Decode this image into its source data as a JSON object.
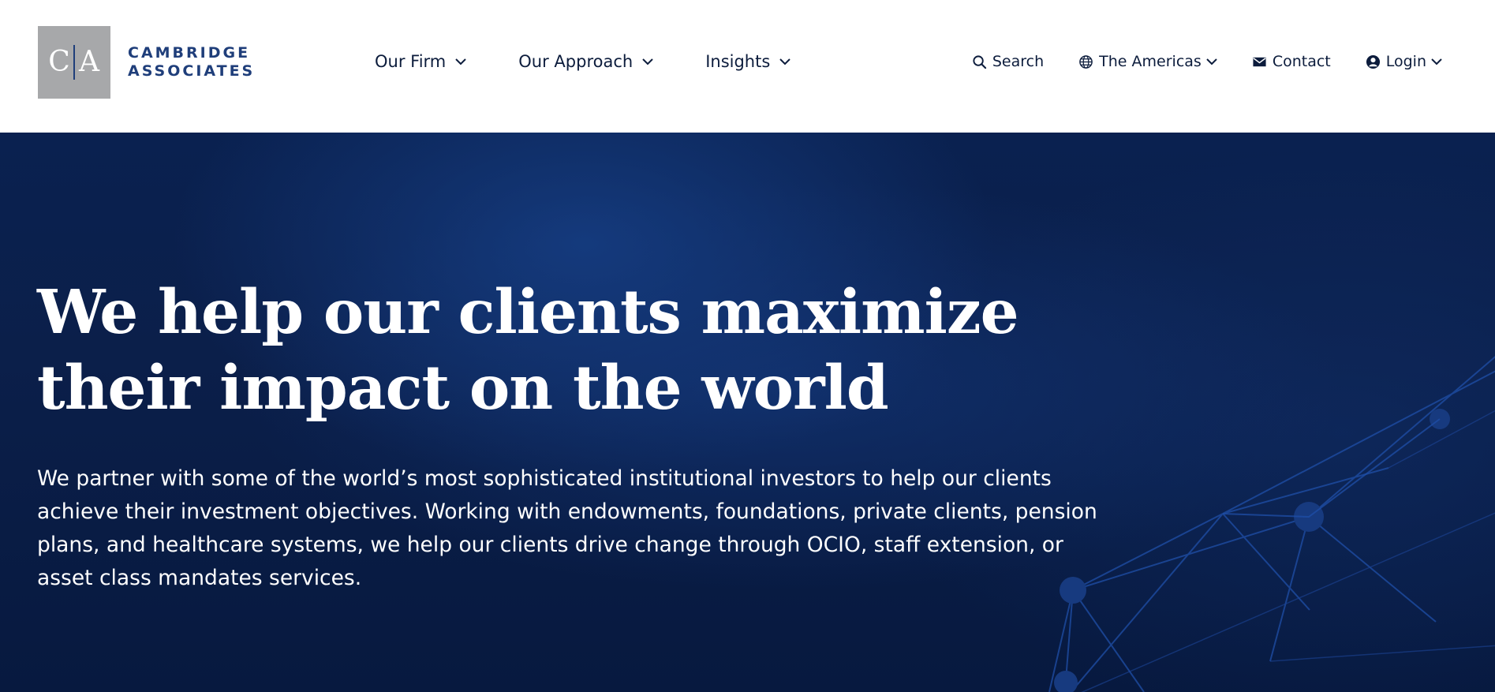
{
  "brand": {
    "logo_left_letter": "C",
    "logo_right_letter": "A",
    "name_line1": "CAMBRIDGE",
    "name_line2": "ASSOCIATES",
    "accent_color": "#1f3e7a",
    "logo_bg_color": "#a7a8aa"
  },
  "nav": {
    "items": [
      {
        "label": "Our Firm",
        "icon": "chevron-down-icon"
      },
      {
        "label": "Our Approach",
        "icon": "chevron-down-icon"
      },
      {
        "label": "Insights",
        "icon": "chevron-down-icon"
      }
    ]
  },
  "utilities": {
    "search": {
      "label": "Search",
      "icon": "search-icon"
    },
    "region": {
      "label": "The Americas",
      "icon": "globe-icon"
    },
    "contact": {
      "label": "Contact",
      "icon": "envelope-icon"
    },
    "login": {
      "label": "Login",
      "icon": "user-icon"
    }
  },
  "hero": {
    "title_line1": "We help our clients maximize",
    "title_line2": "their impact on the world",
    "body": "We partner with some of the world’s most sophisticated institutional investors to help our clients achieve their investment objectives. Working with endowments, foundations, private clients, pension plans, and healthcare systems, we help our clients drive change through OCIO, staff extension, or asset class mandates services.",
    "background_color": "#0b1f4a",
    "text_color": "#ffffff"
  }
}
